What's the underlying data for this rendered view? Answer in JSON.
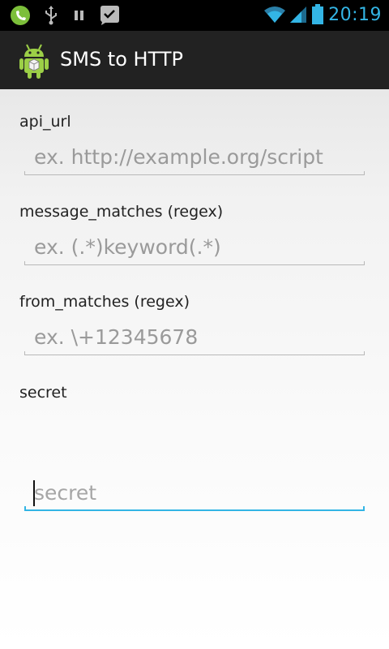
{
  "status_bar": {
    "time": "20:19",
    "left_icons": [
      "phone-icon",
      "usb-icon",
      "pause-icon",
      "check-bubble-icon"
    ],
    "right_icons": [
      "wifi-icon",
      "signal-icon",
      "battery-icon"
    ],
    "accent_color": "#33b5e5"
  },
  "action_bar": {
    "title": "SMS to HTTP",
    "icon": "android-app-icon",
    "background": "#222222"
  },
  "form": {
    "fields": [
      {
        "label": "api_url",
        "placeholder": "ex. http://example.org/script",
        "value": ""
      },
      {
        "label": "message_matches (regex)",
        "placeholder": "ex. (.*)keyword(.*)",
        "value": ""
      },
      {
        "label": "from_matches (regex)",
        "placeholder": "ex. \\+12345678",
        "value": ""
      },
      {
        "label": "secret",
        "placeholder": "secret",
        "value": "",
        "focused": true
      }
    ]
  }
}
